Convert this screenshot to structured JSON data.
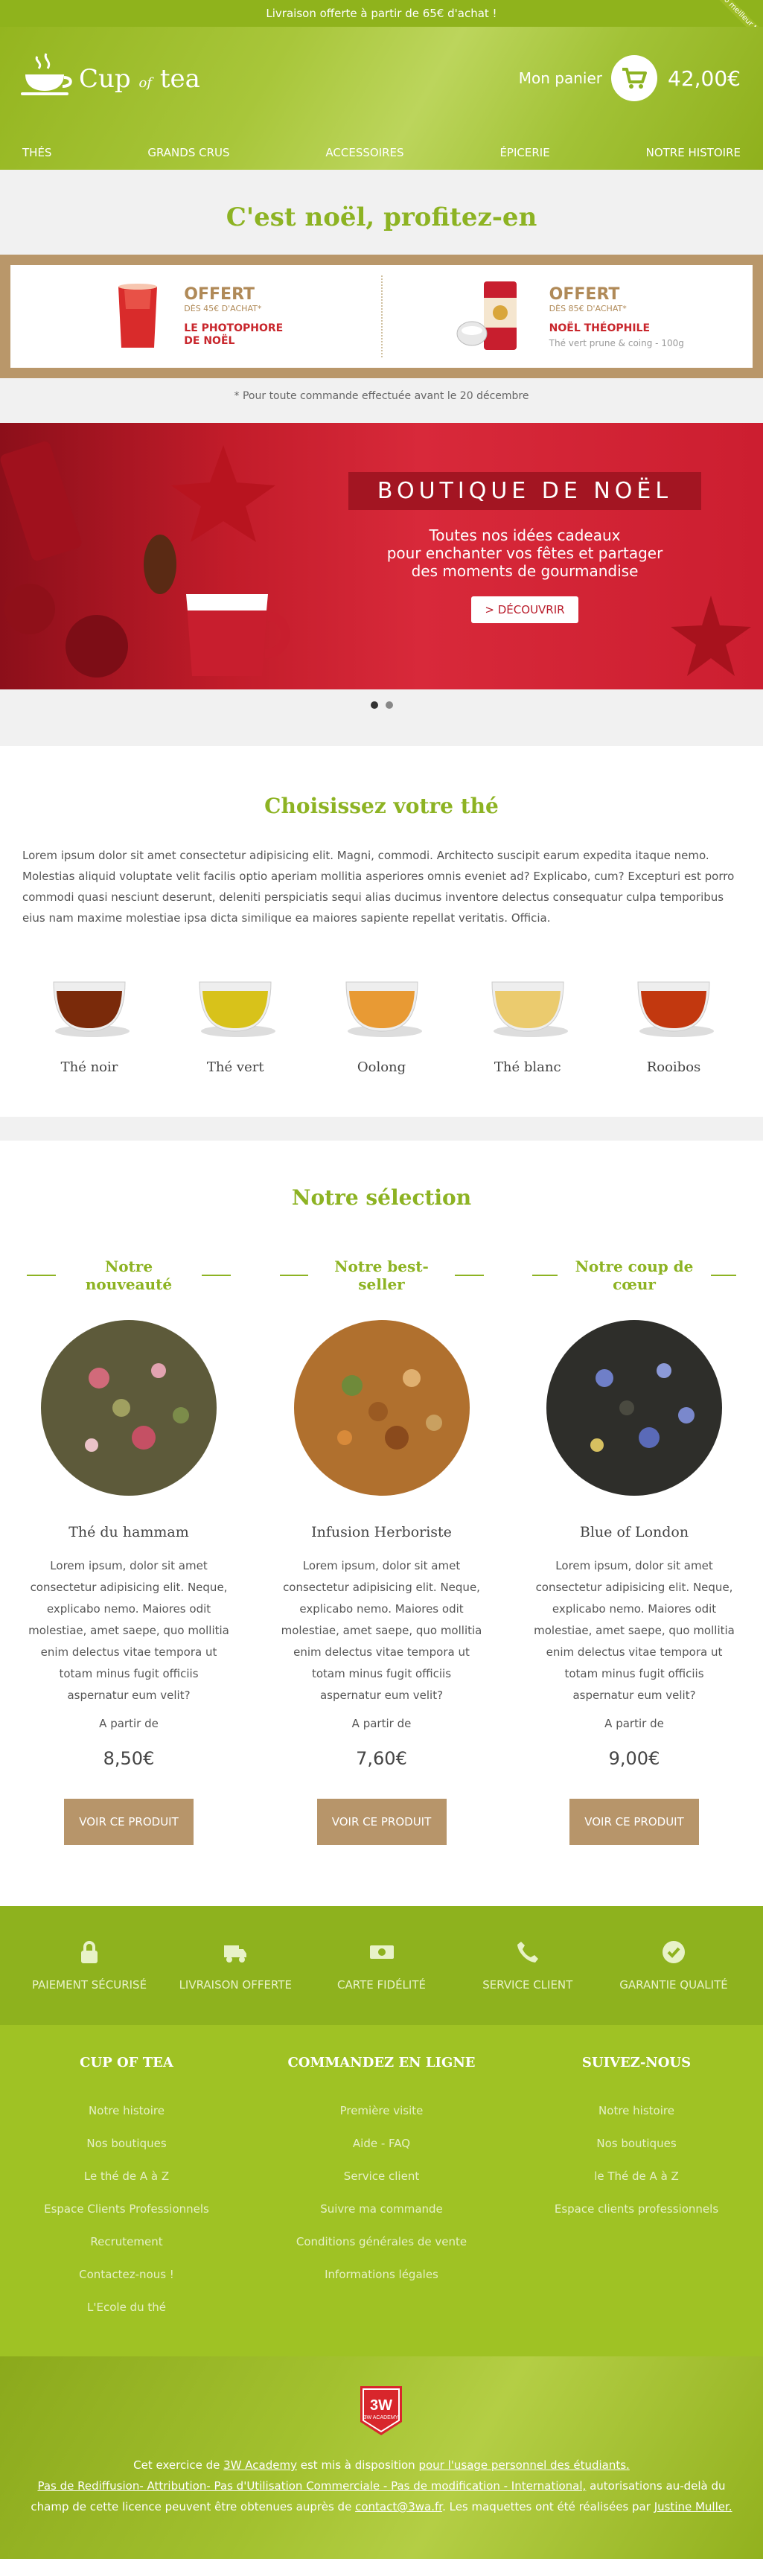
{
  "topbar": {
    "text": "Livraison offerte à partir de 65€ d'achat !",
    "ribbon": "Bio meilleur thé"
  },
  "brand": {
    "name": "Cup",
    "of": "of",
    "tea": "tea"
  },
  "cart": {
    "label": "Mon panier",
    "total": "42,00€"
  },
  "nav": {
    "items": [
      "THÉS",
      "GRANDS CRUS",
      "ACCESSOIRES",
      "ÉPICERIE",
      "NOTRE HISTOIRE"
    ]
  },
  "promo": {
    "title": "C'est noël, profitez-en",
    "offers": [
      {
        "big": "OFFERT",
        "small": "DÈS 45€ D'ACHAT*",
        "product_l1": "LE PHOTOPHORE",
        "product_l2": "DE NOËL",
        "sub": ""
      },
      {
        "big": "OFFERT",
        "small": "DÈS 85€ D'ACHAT*",
        "product_l1": "NOËL THÉOPHILE",
        "product_l2": "",
        "sub": "Thé vert prune & coing - 100g"
      }
    ],
    "note": "* Pour toute commande effectuée avant le 20 décembre"
  },
  "banner": {
    "title": "BOUTIQUE DE NOËL",
    "line1": "Toutes nos idées cadeaux",
    "line2": "pour enchanter vos fêtes et partager",
    "line3": "des moments de gourmandise",
    "button": "> DÉCOUVRIR"
  },
  "choose": {
    "title": "Choisissez votre thé",
    "text": "Lorem ipsum dolor sit amet consectetur adipisicing elit. Magni, commodi. Architecto suscipit earum expedita itaque nemo. Molestias aliquid voluptate velit facilis optio aperiam mollitia asperiores omnis eveniet ad? Explicabo, cum? Excepturi est porro commodi quasi nesciunt deserunt, deleniti perspiciatis sequi alias ducimus inventore delectus consequatur culpa temporibus eius nam maxime molestiae ipsa dicta similique ea maiores sapiente repellat veritatis. Officia.",
    "teas": [
      {
        "name": "Thé noir",
        "color": "#7a2a0a"
      },
      {
        "name": "Thé vert",
        "color": "#d8c21a"
      },
      {
        "name": "Oolong",
        "color": "#e89a34"
      },
      {
        "name": "Thé blanc",
        "color": "#ebcb6e"
      },
      {
        "name": "Rooibos",
        "color": "#c2380f"
      }
    ]
  },
  "selection": {
    "title": "Notre sélection",
    "products": [
      {
        "head": "Notre nouveauté",
        "name": "Thé du hammam",
        "desc": "Lorem ipsum, dolor sit amet consectetur adipisicing elit. Neque, explicabo nemo. Maiores odit molestiae, amet saepe, quo mollitia enim delectus vitae tempora ut totam minus fugit officiis aspernatur eum velit?",
        "from": "A partir de",
        "price": "8,50€",
        "button": "VOIR CE PRODUIT"
      },
      {
        "head": "Notre best-seller",
        "name": "Infusion Herboriste",
        "desc": "Lorem ipsum, dolor sit amet consectetur adipisicing elit. Neque, explicabo nemo. Maiores odit molestiae, amet saepe, quo mollitia enim delectus vitae tempora ut totam minus fugit officiis aspernatur eum velit?",
        "from": "A partir de",
        "price": "7,60€",
        "button": "VOIR CE PRODUIT"
      },
      {
        "head": "Notre coup de cœur",
        "name": "Blue of London",
        "desc": "Lorem ipsum, dolor sit amet consectetur adipisicing elit. Neque, explicabo nemo. Maiores odit molestiae, amet saepe, quo mollitia enim delectus vitae tempora ut totam minus fugit officiis aspernatur eum velit?",
        "from": "A partir de",
        "price": "9,00€",
        "button": "VOIR CE PRODUIT"
      }
    ]
  },
  "features": [
    {
      "label": "PAIEMENT SÉCURISÉ",
      "icon": "lock-icon"
    },
    {
      "label": "LIVRAISON OFFERTE",
      "icon": "truck-icon"
    },
    {
      "label": "CARTE FIDÉLITÉ",
      "icon": "banknote-icon"
    },
    {
      "label": "SERVICE CLIENT",
      "icon": "phone-icon"
    },
    {
      "label": "GARANTIE QUALITÉ",
      "icon": "check-circle-icon"
    }
  ],
  "footer": {
    "cols": [
      {
        "title": "CUP OF TEA",
        "links": [
          "Notre histoire",
          "Nos boutiques",
          "Le thé de A à Z",
          "Espace Clients Professionnels",
          "Recrutement",
          "Contactez-nous !",
          "L'Ecole du thé"
        ]
      },
      {
        "title": "COMMANDEZ EN LIGNE",
        "links": [
          "Première visite",
          "Aide - FAQ",
          "Service client",
          "Suivre ma commande",
          "Conditions générales de vente",
          "Informations légales"
        ]
      },
      {
        "title": "SUIVEZ-NOUS",
        "links": [
          "Notre histoire",
          "Nos boutiques",
          "le Thé de A à Z",
          "Espace clients professionnels"
        ]
      }
    ]
  },
  "credits": {
    "badge": "3W ACADEMY",
    "p1a": "Cet exercice de ",
    "p1_link1": "3W Academy",
    "p1b": " est mis à disposition ",
    "p1_link2": "pour l'usage personnel des étudiants.",
    "p2_link": "Pas de Rediffusion- Attribution- Pas d'Utilisation Commerciale - Pas de modification - International,",
    "p2b": " autorisations au-delà du",
    "p3a": "champ de cette licence peuvent être obtenues auprès de ",
    "p3_link1": "contact@3wa.fr",
    "p3b": ". Les maquettes ont été réalisées par ",
    "p3_link2": "Justine Muller."
  },
  "colors": {
    "green": "#8db323",
    "gold": "#b7956a",
    "red": "#c8262c"
  }
}
